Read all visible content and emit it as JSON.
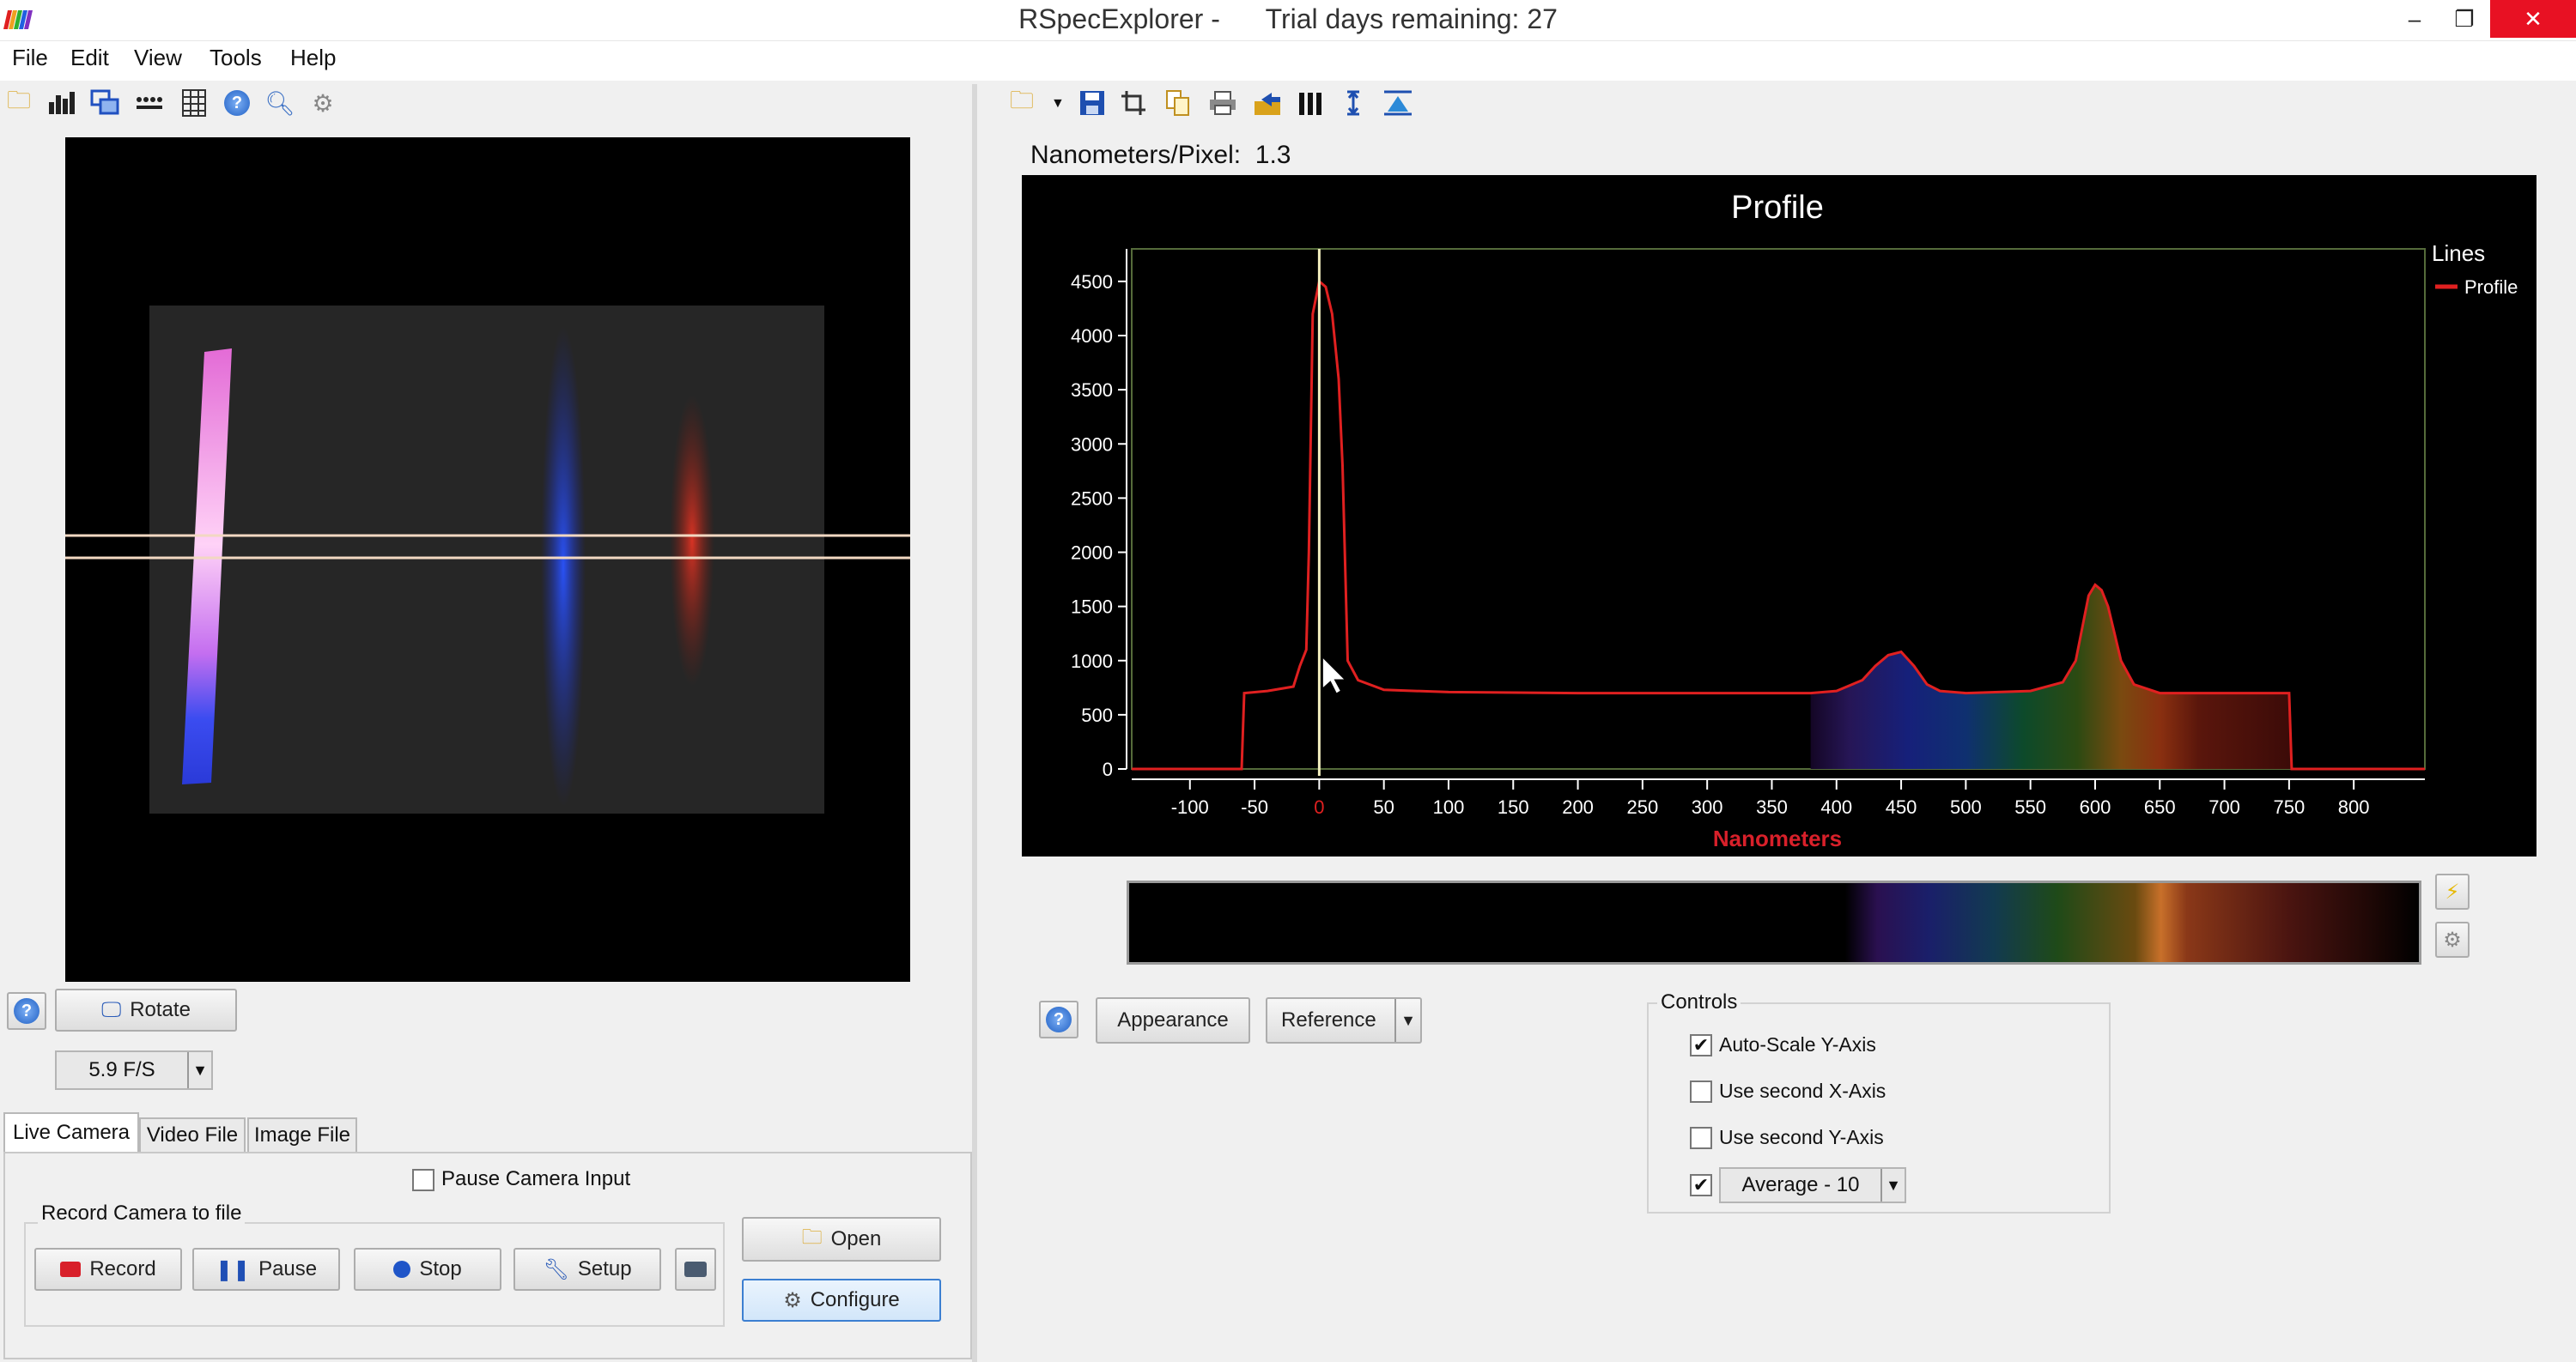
{
  "window": {
    "title": "RSpecExplorer -      Trial days remaining: 27",
    "minimize": "–",
    "restore": "❐",
    "close": "✕"
  },
  "menu": [
    "File",
    "Edit",
    "View",
    "Tools",
    "Help"
  ],
  "left_toolbar_icons": [
    "open-folder-icon",
    "chart-icon",
    "copy-images-icon",
    "dots-icon",
    "grid-icon",
    "help-icon",
    "zoom-icon",
    "settings-icon"
  ],
  "right_toolbar_icons": [
    "open-folder-icon",
    "dropdown-icon",
    "save-icon",
    "crop-icon",
    "copy-icon",
    "print-icon",
    "export-icon",
    "columns-icon",
    "vertical-range-icon",
    "baseline-icon"
  ],
  "camera": {
    "rotate_label": "Rotate",
    "fps_value": "5.9 F/S",
    "tabs": [
      "Live Camera",
      "Video File",
      "Image File"
    ],
    "pause_input_label": "Pause Camera Input",
    "record_group_label": "Record Camera to file",
    "record_label": "Record",
    "pause_label": "Pause",
    "stop_label": "Stop",
    "setup_label": "Setup",
    "open_label": "Open",
    "configure_label": "Configure"
  },
  "spectrum": {
    "nm_per_pixel": "Nanometers/Pixel:  1.3",
    "appearance_label": "Appearance",
    "reference_label": "Reference",
    "controls_label": "Controls",
    "controls": [
      {
        "label": "Auto-Scale Y-Axis",
        "checked": true
      },
      {
        "label": "Use second X-Axis",
        "checked": false
      },
      {
        "label": "Use second Y-Axis",
        "checked": false
      }
    ],
    "average_label": "Average - 10",
    "average_checked": true
  },
  "chart_data": {
    "type": "line",
    "title": "Profile",
    "xlabel": "Nanometers",
    "ylabel": "",
    "xlim": [
      -145,
      855
    ],
    "ylim": [
      0,
      4800
    ],
    "x_ticks": [
      -100,
      -50,
      0,
      50,
      100,
      150,
      200,
      250,
      300,
      350,
      400,
      450,
      500,
      550,
      600,
      650,
      700,
      750,
      800
    ],
    "y_ticks": [
      0,
      500,
      1000,
      1500,
      2000,
      2500,
      3000,
      3500,
      4000,
      4500
    ],
    "legend_title": "Lines",
    "legend_position": "top-right",
    "series": [
      {
        "name": "Profile",
        "color": "#e02020",
        "x": [
          -145,
          -60,
          -58,
          -40,
          -20,
          -15,
          -10,
          -8,
          -5,
          0,
          5,
          10,
          15,
          18,
          22,
          30,
          50,
          100,
          200,
          300,
          380,
          400,
          420,
          430,
          440,
          450,
          460,
          470,
          480,
          500,
          550,
          575,
          585,
          590,
          595,
          600,
          605,
          610,
          615,
          620,
          630,
          650,
          700,
          745,
          750,
          752,
          800,
          855
        ],
        "y": [
          0,
          0,
          700,
          720,
          760,
          950,
          1100,
          2000,
          4200,
          4500,
          4450,
          4200,
          3600,
          2800,
          1000,
          820,
          730,
          710,
          700,
          700,
          700,
          720,
          820,
          950,
          1050,
          1080,
          950,
          780,
          720,
          700,
          720,
          800,
          1000,
          1300,
          1600,
          1700,
          1650,
          1500,
          1250,
          1000,
          780,
          700,
          700,
          700,
          700,
          0,
          0,
          0
        ]
      }
    ],
    "cursor_x": 0,
    "colored_fill_range": [
      380,
      755
    ]
  }
}
